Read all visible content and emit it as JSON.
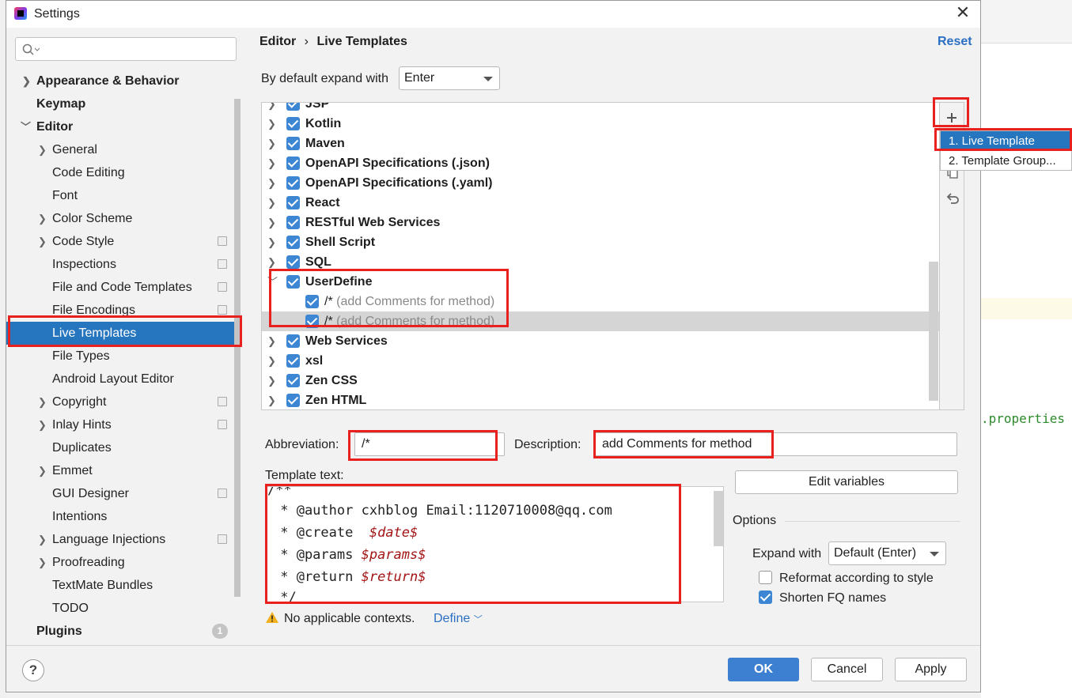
{
  "window": {
    "title": "Settings"
  },
  "search": {
    "placeholder": ""
  },
  "sidebar": {
    "items": [
      {
        "label": "Appearance & Behavior"
      },
      {
        "label": "Keymap"
      },
      {
        "label": "Editor"
      },
      {
        "label": "General"
      },
      {
        "label": "Code Editing"
      },
      {
        "label": "Font"
      },
      {
        "label": "Color Scheme"
      },
      {
        "label": "Code Style"
      },
      {
        "label": "Inspections"
      },
      {
        "label": "File and Code Templates"
      },
      {
        "label": "File Encodings"
      },
      {
        "label": "Live Templates"
      },
      {
        "label": "File Types"
      },
      {
        "label": "Android Layout Editor"
      },
      {
        "label": "Copyright"
      },
      {
        "label": "Inlay Hints"
      },
      {
        "label": "Duplicates"
      },
      {
        "label": "Emmet"
      },
      {
        "label": "GUI Designer"
      },
      {
        "label": "Intentions"
      },
      {
        "label": "Language Injections"
      },
      {
        "label": "Proofreading"
      },
      {
        "label": "TextMate Bundles"
      },
      {
        "label": "TODO"
      },
      {
        "label": "Plugins"
      }
    ],
    "plugins_badge": "1"
  },
  "header": {
    "breadcrumb_parent": "Editor",
    "breadcrumb_sep": "›",
    "breadcrumb_current": "Live Templates",
    "reset": "Reset"
  },
  "expand": {
    "label": "By default expand with",
    "value": "Enter"
  },
  "tree": {
    "rows": [
      {
        "name": "JSP"
      },
      {
        "name": "Kotlin"
      },
      {
        "name": "Maven"
      },
      {
        "name": "OpenAPI Specifications (.json)"
      },
      {
        "name": "OpenAPI Specifications (.yaml)"
      },
      {
        "name": "React"
      },
      {
        "name": "RESTful Web Services"
      },
      {
        "name": "Shell Script"
      },
      {
        "name": "SQL"
      },
      {
        "name": "UserDefine"
      },
      {
        "name": "/*",
        "desc": "(add Comments for method)"
      },
      {
        "name": "/*",
        "desc": "(add Comments for method)"
      },
      {
        "name": "Web Services"
      },
      {
        "name": "xsl"
      },
      {
        "name": "Zen CSS"
      },
      {
        "name": "Zen HTML"
      }
    ]
  },
  "popup": {
    "item1": "1. Live Template",
    "item2": "2. Template Group..."
  },
  "form": {
    "abbrev_label": "Abbreviation:",
    "abbrev_value": "/*",
    "desc_label": "Description:",
    "desc_value": "add Comments for method",
    "template_label": "Template text:",
    "edit_variables": "Edit variables"
  },
  "template_lines": [
    "/**",
    " * @author cxhblog Email:1120710008@qq.com",
    " * @create  ",
    " * @params ",
    " * @return ",
    " */"
  ],
  "template_vars": {
    "date": "$date$",
    "params": "$params$",
    "return": "$return$"
  },
  "options": {
    "title": "Options",
    "expand_label": "Expand with",
    "expand_value": "Default (Enter)",
    "reformat": "Reformat according to style",
    "reformat_checked": false,
    "shorten": "Shorten FQ names",
    "shorten_checked": true
  },
  "context": {
    "warning": "No applicable contexts.",
    "define": "Define"
  },
  "buttons": {
    "ok": "OK",
    "cancel": "Cancel",
    "apply": "Apply",
    "help": "?"
  },
  "background": {
    "code_snippet": ".properties"
  },
  "colors": {
    "accent": "#2675bf",
    "highlight": "#e8201e",
    "primary_button": "#3d7fd1"
  }
}
